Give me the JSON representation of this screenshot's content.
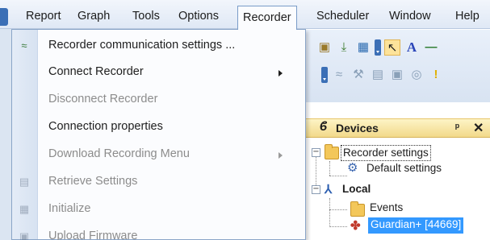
{
  "menubar": {
    "items": [
      {
        "label": "Report"
      },
      {
        "label": "Graph"
      },
      {
        "label": "Tools"
      },
      {
        "label": "Options"
      },
      {
        "label": "Recorder"
      },
      {
        "label": "Scheduler"
      },
      {
        "label": "Window"
      },
      {
        "label": "Help"
      }
    ]
  },
  "recorder_menu": {
    "items": [
      {
        "label": "Recorder communication settings ...",
        "enabled": true,
        "icon": "recorder-comm-icon"
      },
      {
        "label": "Connect Recorder",
        "enabled": true,
        "submenu": true
      },
      {
        "label": "Disconnect Recorder",
        "enabled": false
      },
      {
        "label": "Connection properties",
        "enabled": true
      },
      {
        "label": "Download Recording Menu",
        "enabled": false,
        "submenu": true
      },
      {
        "label": "Retrieve Settings",
        "enabled": false,
        "icon": "retrieve-settings-icon"
      },
      {
        "label": "Initialize",
        "enabled": false,
        "icon": "initialize-icon"
      },
      {
        "label": "Upload Firmware",
        "enabled": false,
        "icon": "upload-firmware-icon"
      }
    ]
  },
  "devices_panel": {
    "title": "Devices",
    "pin": "ᵖ",
    "close": "✕",
    "tree": {
      "recorder_settings": "Recorder settings",
      "default_settings": "Default settings",
      "local": "Local",
      "events": "Events",
      "guardian": "Guardian+ [44669]"
    }
  },
  "colors": {
    "menubar_bg": "#dfe8f5",
    "dropdown_bg": "#fbfcfe",
    "devices_header": "#f2d98a",
    "selection": "#3399ff",
    "disabled_text": "#8c8c8c"
  }
}
